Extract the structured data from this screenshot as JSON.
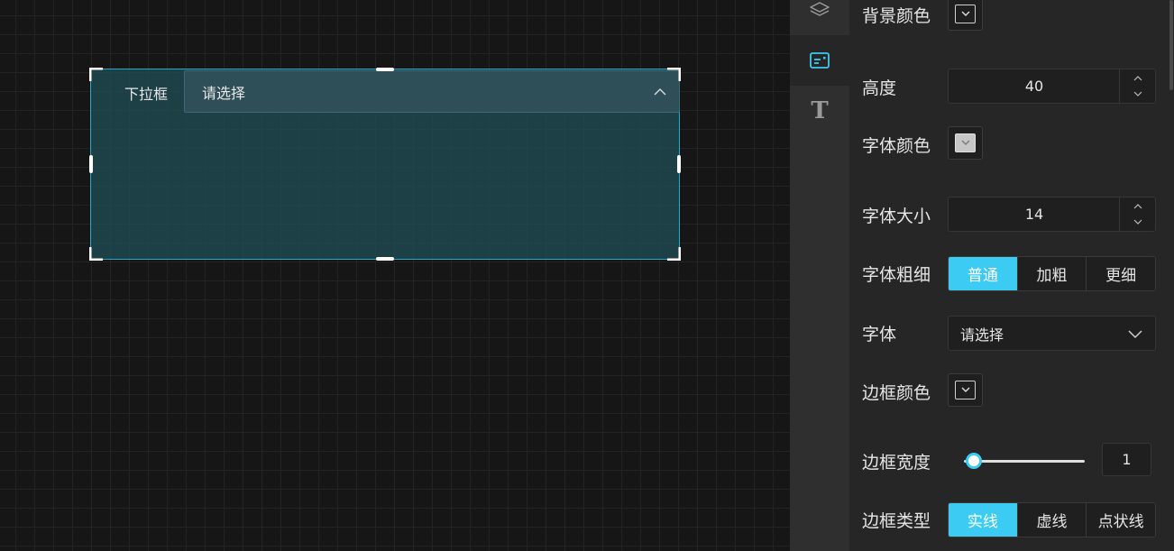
{
  "canvas": {
    "widget": {
      "label": "下拉框",
      "placeholder": "请选择"
    }
  },
  "toolstrip": {
    "tools": [
      {
        "icon": "layers-icon"
      },
      {
        "icon": "component-card-icon"
      },
      {
        "icon": "text-icon",
        "glyph": "T"
      }
    ],
    "active_index": 1
  },
  "panel": {
    "background_color": {
      "label": "背景颜色"
    },
    "height": {
      "label": "高度",
      "value": "40"
    },
    "font_color": {
      "label": "字体颜色"
    },
    "font_size": {
      "label": "字体大小",
      "value": "14"
    },
    "font_weight": {
      "label": "字体粗细",
      "options": [
        "普通",
        "加粗",
        "更细"
      ],
      "selected": 0
    },
    "font_family": {
      "label": "字体",
      "placeholder": "请选择"
    },
    "border_color": {
      "label": "边框颜色"
    },
    "border_width": {
      "label": "边框宽度",
      "value": "1",
      "slider_fraction": 0.0
    },
    "border_type": {
      "label": "边框类型",
      "options": [
        "实线",
        "虚线",
        "点状线"
      ],
      "selected": 0
    }
  },
  "colors": {
    "accent": "#3ccbf3",
    "widget_border": "#2ea6c4",
    "panel_bg": "#262626",
    "canvas_bg": "#161616"
  }
}
